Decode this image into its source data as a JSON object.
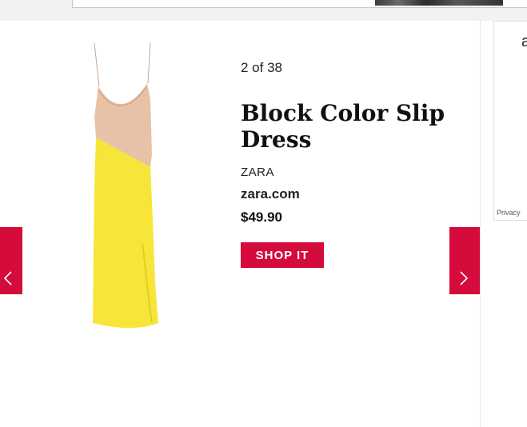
{
  "gallery": {
    "counter": "2 of 38",
    "product": {
      "title": "Block Color Slip Dress",
      "brand": "ZARA",
      "retailer": "zara.com",
      "price": "$49.90",
      "cta_label": "SHOP IT",
      "image_icon": "slip-dress-image"
    },
    "nav": {
      "prev_icon": "chevron-left-icon",
      "next_icon": "chevron-right-icon"
    }
  },
  "sidebar_ad": {
    "partial_text": "a",
    "privacy_label": "Privacy"
  },
  "colors": {
    "accent": "#d50b3b",
    "dress_top": "#e8c2a6",
    "dress_bottom": "#f7e53a"
  }
}
